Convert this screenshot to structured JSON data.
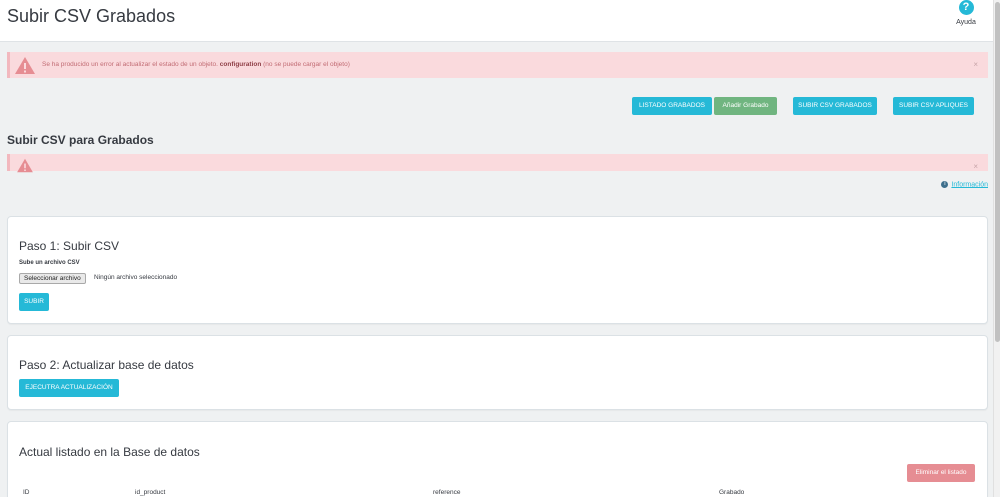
{
  "header": {
    "title": "Subir CSV Grabados",
    "help_icon": "?",
    "help_label": "Ayuda"
  },
  "alerts": {
    "top": {
      "prefix": "Se ha producido un error al actualizar el estado de un objeto.",
      "object": "configuration",
      "suffix": "(no se puede cargar el objeto)",
      "close": "×"
    },
    "second": {
      "close": "×"
    }
  },
  "toolbar": {
    "listado": "LISTADO GRABADOS",
    "anadir": "Añadir Grabado",
    "subir_grabados": "SUBIR CSV GRABADOS",
    "subir_apliques": "SUBIR CSV APLIQUES"
  },
  "section": {
    "title": "Subir CSV para Grabados",
    "info_icon": "i",
    "info_link": "Información"
  },
  "paso1": {
    "title": "Paso 1: Subir CSV",
    "field_label": "Sube un archivo CSV",
    "file_button": "Seleccionar archivo",
    "file_status": "Ningún archivo seleccionado",
    "submit": "SUBIR"
  },
  "paso2": {
    "title": "Paso 2: Actualizar base de datos",
    "button": "EJECUTRA ACTUALIZACIÓN"
  },
  "listado": {
    "title": "Actual listado en la Base de datos",
    "delete_button": "Eliminar el listado",
    "columns": [
      "ID",
      "id_product",
      "reference",
      "Grabado"
    ]
  },
  "colors": {
    "primary": "#25b9d7",
    "success": "#70b580",
    "danger": "#e68d93",
    "alert_bg": "#fadadd"
  }
}
